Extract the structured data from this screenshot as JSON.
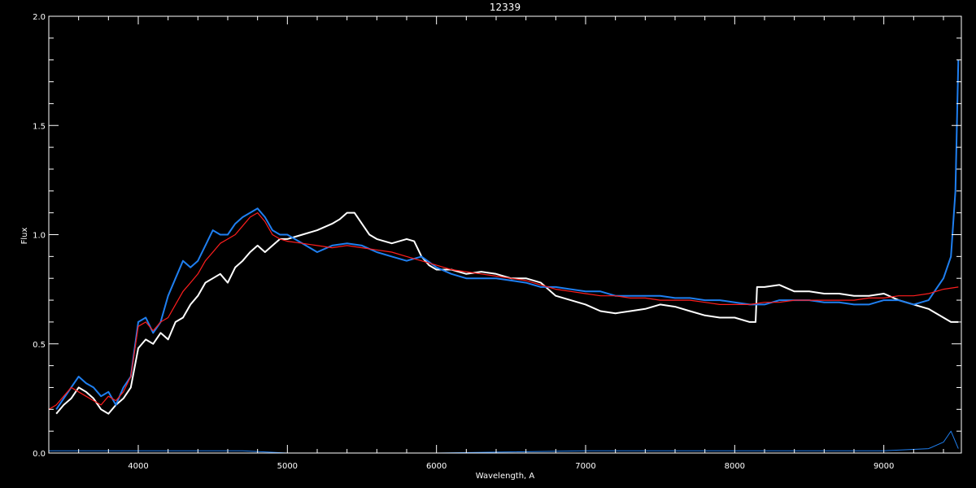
{
  "chart_data": {
    "type": "line",
    "title": "12339",
    "xlabel": "Wavelength, A",
    "ylabel": "Flux",
    "xlim": [
      3400,
      9520
    ],
    "ylim": [
      0.0,
      2.0
    ],
    "x_major_ticks": [
      4000,
      5000,
      6000,
      7000,
      8000,
      9000
    ],
    "x_tick_labels": [
      "4000",
      "5000",
      "6000",
      "7000",
      "8000",
      "9000"
    ],
    "x_minor_step": 200,
    "y_major_ticks": [
      0.0,
      0.5,
      1.0,
      1.5,
      2.0
    ],
    "y_tick_labels": [
      "0.0",
      "0.5",
      "1.0",
      "1.5",
      "2.0"
    ],
    "y_minor_step": 0.1,
    "grid": false,
    "background": "#000000",
    "series": [
      {
        "key": "white",
        "color": "#ffffff",
        "x": [
          3450,
          3500,
          3550,
          3600,
          3650,
          3700,
          3750,
          3800,
          3850,
          3900,
          3950,
          4000,
          4050,
          4100,
          4150,
          4200,
          4250,
          4300,
          4350,
          4400,
          4450,
          4500,
          4550,
          4600,
          4650,
          4700,
          4750,
          4800,
          4850,
          4900,
          4950,
          5000,
          5100,
          5200,
          5300,
          5350,
          5400,
          5450,
          5500,
          5550,
          5600,
          5700,
          5800,
          5850,
          5900,
          5950,
          6000,
          6100,
          6200,
          6300,
          6400,
          6500,
          6600,
          6700,
          6800,
          6900,
          7000,
          7100,
          7200,
          7300,
          7400,
          7500,
          7600,
          7700,
          7800,
          7900,
          8000,
          8100,
          8140,
          8150,
          8200,
          8300,
          8400,
          8500,
          8600,
          8700,
          8800,
          8900,
          9000,
          9100,
          9200,
          9300,
          9400,
          9450,
          9500
        ],
        "values": [
          0.18,
          0.22,
          0.25,
          0.3,
          0.28,
          0.25,
          0.2,
          0.18,
          0.22,
          0.25,
          0.3,
          0.48,
          0.52,
          0.5,
          0.55,
          0.52,
          0.6,
          0.62,
          0.68,
          0.72,
          0.78,
          0.8,
          0.82,
          0.78,
          0.85,
          0.88,
          0.92,
          0.95,
          0.92,
          0.95,
          0.98,
          0.98,
          1.0,
          1.02,
          1.05,
          1.07,
          1.1,
          1.1,
          1.05,
          1.0,
          0.98,
          0.96,
          0.98,
          0.97,
          0.9,
          0.86,
          0.84,
          0.84,
          0.82,
          0.83,
          0.82,
          0.8,
          0.8,
          0.78,
          0.72,
          0.7,
          0.68,
          0.65,
          0.64,
          0.65,
          0.66,
          0.68,
          0.67,
          0.65,
          0.63,
          0.62,
          0.62,
          0.6,
          0.6,
          0.76,
          0.76,
          0.77,
          0.74,
          0.74,
          0.73,
          0.73,
          0.72,
          0.72,
          0.73,
          0.7,
          0.68,
          0.66,
          0.62,
          0.6,
          0.6
        ]
      },
      {
        "key": "blue",
        "color": "#1f7ff0",
        "x": [
          3450,
          3500,
          3550,
          3600,
          3650,
          3700,
          3750,
          3800,
          3850,
          3900,
          3950,
          4000,
          4050,
          4100,
          4150,
          4200,
          4250,
          4300,
          4350,
          4400,
          4450,
          4500,
          4550,
          4600,
          4650,
          4700,
          4750,
          4800,
          4850,
          4900,
          4950,
          5000,
          5100,
          5200,
          5300,
          5400,
          5500,
          5600,
          5700,
          5800,
          5900,
          6000,
          6100,
          6200,
          6300,
          6400,
          6500,
          6600,
          6700,
          6800,
          6900,
          7000,
          7100,
          7200,
          7300,
          7400,
          7500,
          7600,
          7700,
          7800,
          7900,
          8000,
          8100,
          8200,
          8300,
          8400,
          8500,
          8600,
          8700,
          8800,
          8900,
          9000,
          9100,
          9200,
          9300,
          9350,
          9400,
          9450,
          9480,
          9500
        ],
        "values": [
          0.2,
          0.25,
          0.3,
          0.35,
          0.32,
          0.3,
          0.26,
          0.28,
          0.22,
          0.3,
          0.35,
          0.6,
          0.62,
          0.55,
          0.6,
          0.72,
          0.8,
          0.88,
          0.85,
          0.88,
          0.95,
          1.02,
          1.0,
          1.0,
          1.05,
          1.08,
          1.1,
          1.12,
          1.08,
          1.02,
          1.0,
          1.0,
          0.96,
          0.92,
          0.95,
          0.96,
          0.95,
          0.92,
          0.9,
          0.88,
          0.9,
          0.85,
          0.82,
          0.8,
          0.8,
          0.8,
          0.79,
          0.78,
          0.76,
          0.76,
          0.75,
          0.74,
          0.74,
          0.72,
          0.72,
          0.72,
          0.72,
          0.71,
          0.71,
          0.7,
          0.7,
          0.69,
          0.68,
          0.68,
          0.7,
          0.7,
          0.7,
          0.69,
          0.69,
          0.68,
          0.68,
          0.7,
          0.7,
          0.68,
          0.7,
          0.75,
          0.8,
          0.9,
          1.2,
          1.8
        ]
      },
      {
        "key": "red",
        "color": "#ff1e1e",
        "x": [
          3400,
          3450,
          3500,
          3550,
          3600,
          3650,
          3700,
          3750,
          3800,
          3850,
          3900,
          3950,
          4000,
          4050,
          4100,
          4150,
          4200,
          4250,
          4300,
          4350,
          4400,
          4450,
          4500,
          4550,
          4600,
          4650,
          4700,
          4750,
          4800,
          4850,
          4900,
          4950,
          5000,
          5100,
          5200,
          5300,
          5400,
          5500,
          5600,
          5700,
          5800,
          5900,
          6000,
          6100,
          6200,
          6300,
          6400,
          6500,
          6600,
          6700,
          6800,
          6900,
          7000,
          7100,
          7200,
          7300,
          7400,
          7500,
          7600,
          7700,
          7800,
          7900,
          8000,
          8100,
          8200,
          8300,
          8400,
          8500,
          8600,
          8700,
          8800,
          8900,
          9000,
          9100,
          9200,
          9300,
          9400,
          9500
        ],
        "values": [
          0.2,
          0.22,
          0.26,
          0.3,
          0.28,
          0.26,
          0.24,
          0.22,
          0.26,
          0.24,
          0.28,
          0.35,
          0.58,
          0.6,
          0.56,
          0.6,
          0.62,
          0.68,
          0.74,
          0.78,
          0.82,
          0.88,
          0.92,
          0.96,
          0.98,
          1.0,
          1.04,
          1.08,
          1.1,
          1.06,
          1.0,
          0.98,
          0.97,
          0.96,
          0.95,
          0.94,
          0.95,
          0.94,
          0.93,
          0.92,
          0.9,
          0.88,
          0.86,
          0.84,
          0.83,
          0.82,
          0.81,
          0.8,
          0.79,
          0.77,
          0.75,
          0.74,
          0.73,
          0.72,
          0.72,
          0.71,
          0.71,
          0.7,
          0.7,
          0.7,
          0.69,
          0.68,
          0.68,
          0.68,
          0.69,
          0.69,
          0.7,
          0.7,
          0.7,
          0.7,
          0.7,
          0.71,
          0.71,
          0.72,
          0.72,
          0.73,
          0.75,
          0.76
        ]
      },
      {
        "key": "noise",
        "color": "#1f7ff0",
        "x": [
          3400,
          4700,
          5000,
          6000,
          7000,
          8000,
          9000,
          9300,
          9400,
          9450,
          9500
        ],
        "values": [
          0.01,
          0.01,
          0.0,
          0.0,
          0.01,
          0.01,
          0.01,
          0.02,
          0.05,
          0.1,
          0.02
        ]
      }
    ]
  }
}
